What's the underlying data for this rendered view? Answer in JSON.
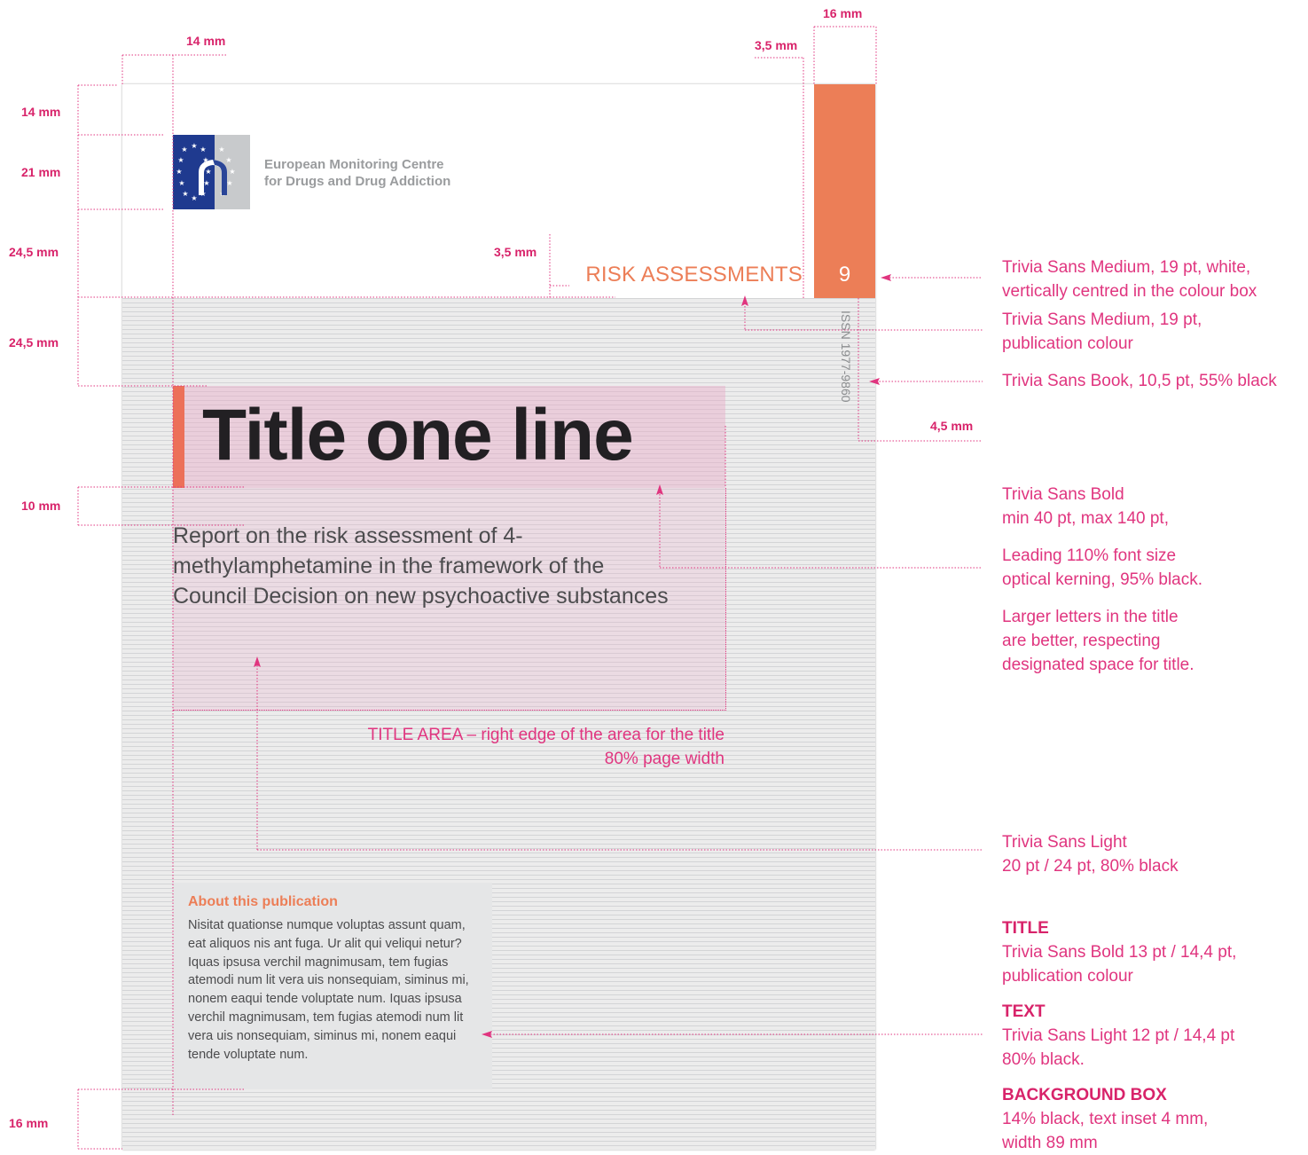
{
  "logo": {
    "name_line1": "European Monitoring Centre",
    "name_line2": "for Drugs and Drug Addiction"
  },
  "cover": {
    "series": "RISK ASSESSMENTS",
    "issue_number": "9",
    "issn": "ISSN 1977-9860",
    "title": "Title one line",
    "subtitle": "Report on the risk assessment of 4-methylamphetamine in the framework of the Council Decision on new psychoactive substances",
    "about_title": "About this publication",
    "about_text": "Nisitat quationse numque voluptas assunt quam, eat aliquos nis ant fuga. Ur alit qui veliqui netur? Iquas ipsusa verchil magnimusam, tem fugias atemodi num lit vera uis nonsequiam, siminus mi, nonem eaqui tende voluptate num. Iquas ipsusa verchil magnimusam, tem fugias atemodi num lit vera uis nonsequiam, siminus mi, nonem eaqui tende voluptate num."
  },
  "dimensions": {
    "margin_left": "14 mm",
    "top_margin": "14 mm",
    "logo_height": "21 mm",
    "header_space": "24,5 mm",
    "title_space": "24,5 mm",
    "title_gap": "10 mm",
    "bottom_margin": "16 mm",
    "box_width": "16 mm",
    "box_gap": "3,5 mm",
    "series_gap": "3,5 mm",
    "issn_offset": "4,5 mm"
  },
  "annotations": {
    "number_spec_1": "Trivia Sans Medium, 19 pt, white,",
    "number_spec_2": "vertically centred in the colour box",
    "series_spec_1": "Trivia Sans Medium, 19 pt,",
    "series_spec_2": "publication colour",
    "issn_spec": "Trivia Sans Book, 10,5 pt, 55% black",
    "title_spec_1": "Trivia Sans Bold",
    "title_spec_2": "min 40 pt, max 140 pt,",
    "title_spec_3": "Leading 110% font size",
    "title_spec_4": "optical kerning, 95% black.",
    "title_spec_5": "Larger letters in the title",
    "title_spec_6": "are better, respecting",
    "title_spec_7": "designated space for title.",
    "title_area_1": "TITLE AREA – right edge of the area for the title",
    "title_area_2": "80% page width",
    "subtitle_spec_1": "Trivia Sans Light",
    "subtitle_spec_2": "20 pt / 24 pt, 80% black",
    "box_title_heading": "TITLE",
    "box_title_1": "Trivia Sans Bold 13 pt / 14,4 pt,",
    "box_title_2": "publication colour",
    "box_text_heading": "TEXT",
    "box_text_1": "Trivia Sans Light 12 pt / 14,4 pt",
    "box_text_2": "80% black.",
    "box_bg_heading": "BACKGROUND BOX",
    "box_bg_1": "14% black, text inset 4 mm,",
    "box_bg_2": "width 89 mm"
  },
  "colors": {
    "publication": "#ec7e57",
    "annotation": "#e0357f",
    "eu_blue": "#1f3a8f"
  }
}
